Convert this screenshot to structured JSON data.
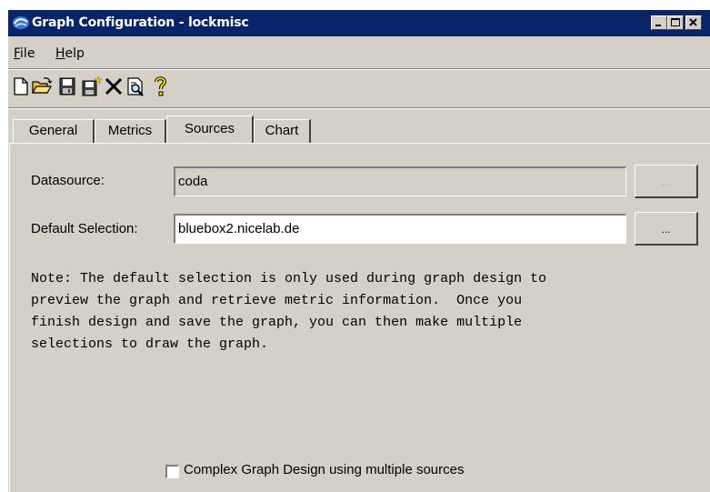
{
  "window": {
    "title": "Graph Configuration - lockmisc",
    "controls": {
      "minimize": "minimize",
      "maximize": "maximize",
      "close": "close"
    }
  },
  "menu": {
    "file": {
      "mnemonic": "F",
      "rest": "ile"
    },
    "help": {
      "mnemonic": "H",
      "rest": "elp"
    }
  },
  "toolbar": {
    "icons": [
      "new-icon",
      "open-folder-icon",
      "save-icon",
      "save-as-icon",
      "delete-icon",
      "preview-icon",
      "help-icon"
    ]
  },
  "tabs": [
    {
      "label": "General",
      "active": false
    },
    {
      "label": "Metrics",
      "active": false
    },
    {
      "label": "Sources",
      "active": true
    },
    {
      "label": "Chart",
      "active": false
    }
  ],
  "sources": {
    "datasource_label": "Datasource:",
    "datasource_value": "coda",
    "datasource_browse": "...",
    "default_selection_label": "Default Selection:",
    "default_selection_value": "bluebox2.nicelab.de",
    "default_selection_browse": "...",
    "note_lines": [
      "Note: The default selection is only used during graph design to",
      "preview the graph and retrieve metric information.  Once you",
      "finish design and save the graph, you can then make multiple",
      "selections to draw the graph."
    ],
    "complex_design_label": "Complex Graph Design using multiple sources",
    "complex_design_checked": false
  },
  "colors": {
    "title_bar": "#0a246a",
    "face": "#d4d0c8"
  }
}
